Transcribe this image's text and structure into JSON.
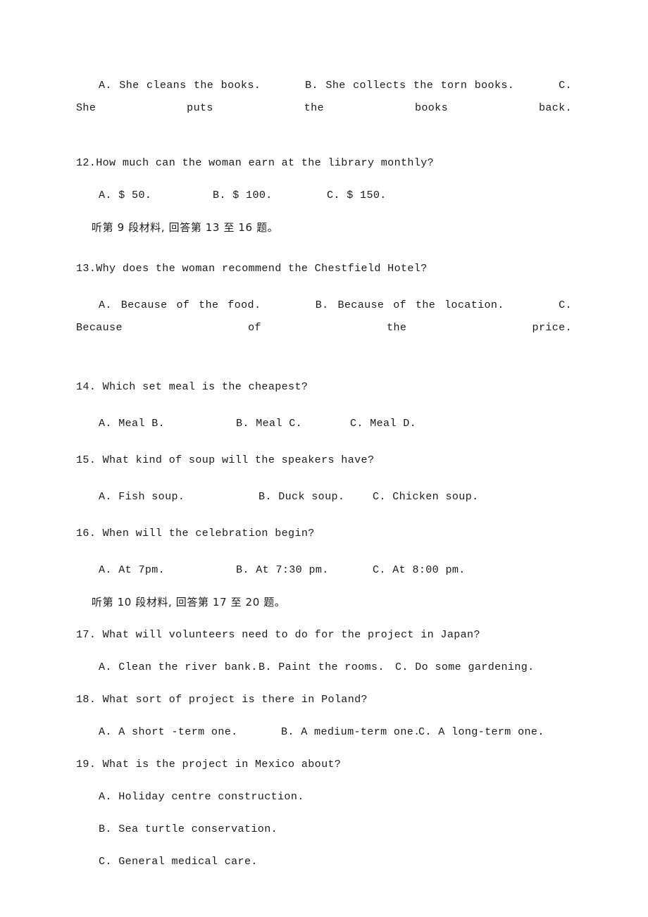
{
  "document": {
    "kind": "exam-worksheet",
    "section": "listening-comprehension",
    "page_background": "#ffffff",
    "text_color": "#1a1a1a"
  },
  "q11_options": {
    "a": "A. She cleans the books.",
    "b": "B. She collects the torn books.",
    "c": "C. She puts the books",
    "c_wrap": "back."
  },
  "q12": {
    "stem": "12.How much can the woman earn at the library monthly?",
    "a": "A. $ 50.",
    "b": "B. $ 100.",
    "c": "C. $ 150."
  },
  "note_9": "听第 9 段材料, 回答第 13 至 16 题。",
  "q13": {
    "stem": "13.Why does the woman recommend the Chestfield Hotel?",
    "a": "A. Because of the food.",
    "b": "B. Because of the location.",
    "c": "C. Because of the",
    "c_wrap": "price."
  },
  "q14": {
    "stem": "14. Which set meal is the cheapest?",
    "a": "A. Meal B.",
    "b": "B. Meal C.",
    "c": "C. Meal D."
  },
  "q15": {
    "stem": "15. What kind of soup will the speakers have?",
    "a": "A. Fish soup.",
    "b": "B. Duck soup.",
    "c": "C. Chicken soup."
  },
  "q16": {
    "stem": "16. When will the celebration begin?",
    "a": "A. At 7pm.",
    "b": "B. At 7:30 pm.",
    "c": "C. At 8:00 pm."
  },
  "note_10": "听第 10 段材料, 回答第 17 至 20 题。",
  "q17": {
    "stem": "17. What will volunteers need to do for the project in Japan?",
    "a": "A. Clean the river bank.",
    "b": "B. Paint the rooms.",
    "c": "C. Do some gardening."
  },
  "q18": {
    "stem": "18. What sort of project is there in Poland?",
    "a": "A. A short -term one.",
    "b": "B. A medium-term one.",
    "c": "C. A long-term one."
  },
  "q19": {
    "stem": "19. What is the project in Mexico about?",
    "a": "A. Holiday centre construction.",
    "b": "B. Sea turtle conservation.",
    "c": "C. General medical care."
  }
}
